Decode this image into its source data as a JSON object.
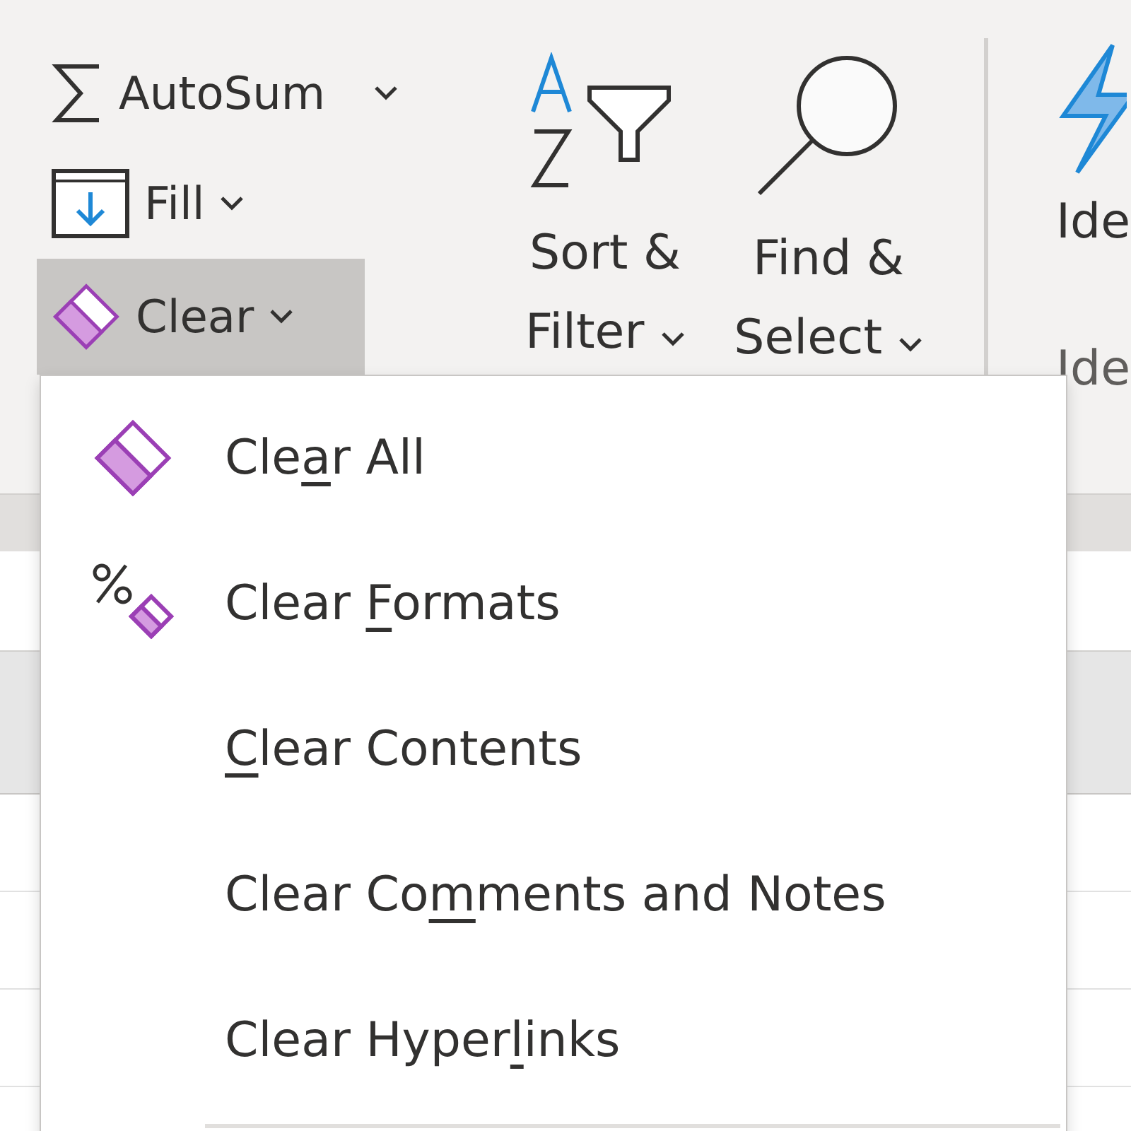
{
  "ribbon": {
    "small_buttons": [
      {
        "kind": "autosum",
        "label": "AutoSum",
        "selected": false
      },
      {
        "kind": "fill",
        "label": "Fill",
        "selected": false
      },
      {
        "kind": "clear",
        "label": "Clear",
        "selected": true
      }
    ],
    "large_buttons": [
      {
        "kind": "sort",
        "lines": [
          "Sort &",
          "Filter"
        ]
      },
      {
        "kind": "find",
        "lines": [
          "Find &",
          "Select"
        ]
      }
    ],
    "ideas": {
      "button_label": "Ide",
      "group_label": "Ide"
    }
  },
  "clear_menu": {
    "items": [
      {
        "kind": "eraser",
        "label": {
          "before": "Cle",
          "key": "a",
          "after": "r All"
        }
      },
      {
        "kind": "format-eraser",
        "label": {
          "before": "Clear ",
          "key": "F",
          "after": "ormats"
        }
      },
      {
        "kind": "plain",
        "label": {
          "key": "C",
          "after": "lear Contents"
        }
      },
      {
        "kind": "plain",
        "label": {
          "before": "Clear Co",
          "key": "m",
          "after": "ments and Notes"
        }
      },
      {
        "kind": "plain",
        "label": {
          "before": "Clear Hyper",
          "key": "l",
          "after": "inks"
        }
      }
    ]
  }
}
